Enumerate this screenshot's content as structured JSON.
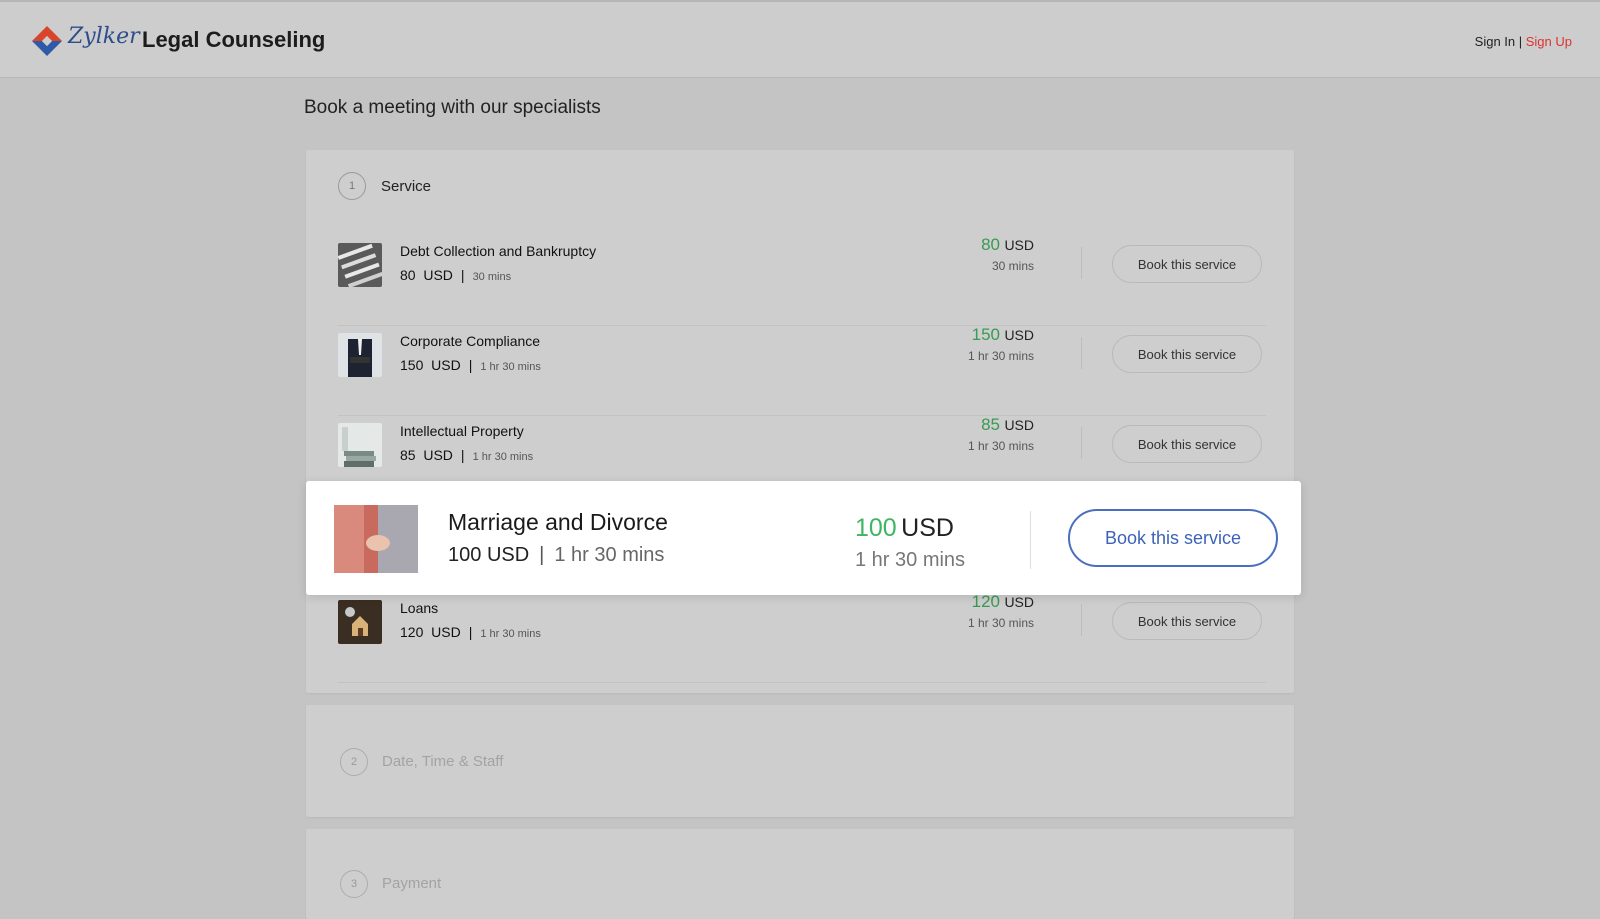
{
  "header": {
    "logo_text": "Zylker",
    "site_title": "Legal Counseling",
    "sign_in": "Sign In",
    "separator": " | ",
    "sign_up": "Sign Up"
  },
  "page": {
    "heading": "Book a meeting with our specialists"
  },
  "steps": [
    {
      "number": "1",
      "label": "Service"
    },
    {
      "number": "2",
      "label": "Date, Time & Staff"
    },
    {
      "number": "3",
      "label": "Payment"
    }
  ],
  "services": [
    {
      "name": "Debt Collection and Bankruptcy",
      "price": "80",
      "currency": "USD",
      "duration": "30 mins",
      "button": "Book this service",
      "image": "documents-photo"
    },
    {
      "name": "Corporate Compliance",
      "price": "150",
      "currency": "USD",
      "duration": "1 hr 30 mins",
      "button": "Book this service",
      "image": "businessman-photo"
    },
    {
      "name": "Intellectual Property",
      "price": "85",
      "currency": "USD",
      "duration": "1 hr 30 mins",
      "button": "Book this service",
      "image": "books-photo"
    },
    {
      "name": "Marriage and Divorce",
      "price": "100",
      "currency": "USD",
      "duration_meta": "1 hr 30  mins",
      "duration": "1 hr 30 mins",
      "button": "Book this service",
      "image": "couple-photo"
    },
    {
      "name": "Loans",
      "price": "120",
      "currency": "USD",
      "duration": "1 hr 30 mins",
      "button": "Book this service",
      "image": "house-keys-photo"
    }
  ],
  "meta_separator": "|",
  "colors": {
    "accent_green": "#3a9a52",
    "signup_red": "#dd3333",
    "button_blue": "#3d63b8"
  }
}
